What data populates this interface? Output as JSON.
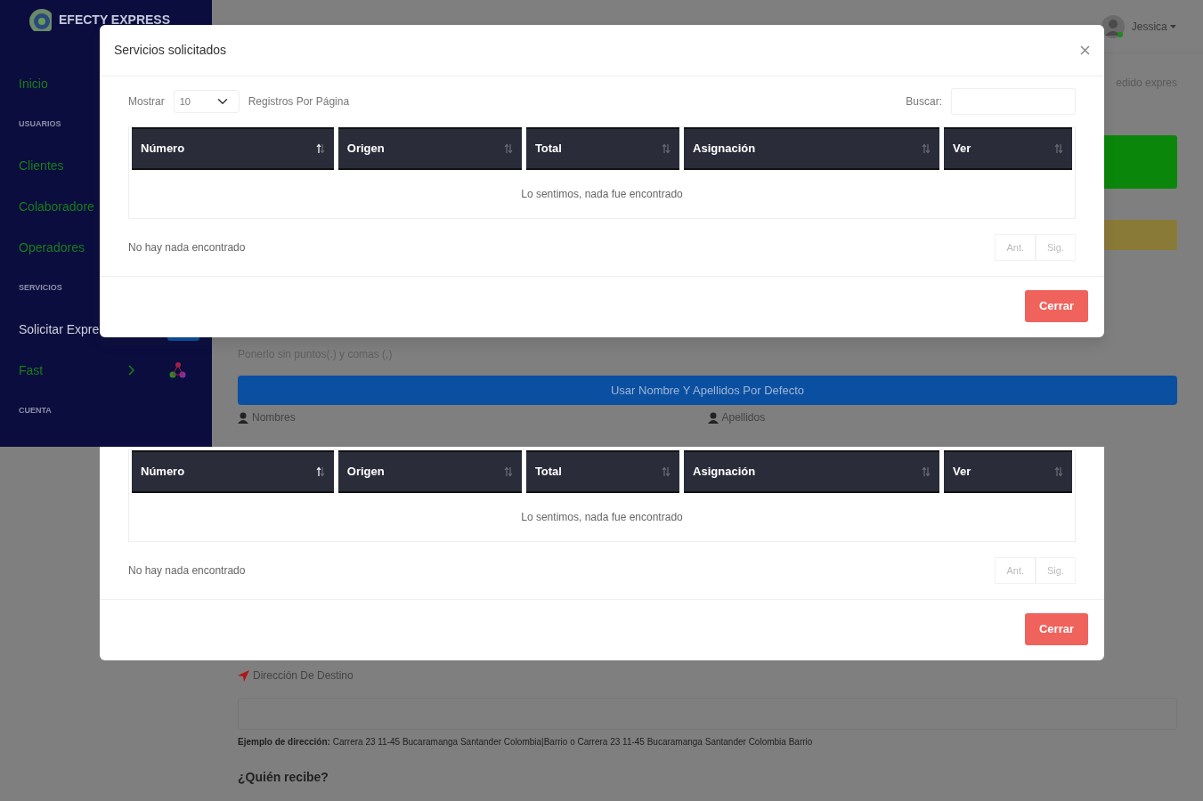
{
  "sidebar": {
    "brand": "EFECTY EXPRESS",
    "items": [
      {
        "kind": "link",
        "label": "Inicio",
        "selected": false
      },
      {
        "kind": "heading",
        "label": "USUARIOS",
        "selected": false
      },
      {
        "kind": "link",
        "label": "Clientes",
        "selected": false
      },
      {
        "kind": "link",
        "label": "Colaboradore",
        "selected": false
      },
      {
        "kind": "link",
        "label": "Operadores",
        "selected": false
      },
      {
        "kind": "heading",
        "label": "SERVICIOS",
        "selected": false
      },
      {
        "kind": "app",
        "label": "Solicitar Expre",
        "selected": true
      },
      {
        "kind": "submenu",
        "label": "Fast",
        "selected": false
      },
      {
        "kind": "heading",
        "label": "CUENTA",
        "selected": false
      }
    ]
  },
  "topbar": {
    "user": "Jessica"
  },
  "content": {
    "side_text": "edido expres",
    "hint": "Ponerlo sin puntos(.) y comas (,)",
    "default_button": "Usar Nombre Y Apellidos Por Defecto",
    "name_labels": [
      "Nombres",
      "Apellidos"
    ],
    "destination_label": "Dirección De Destino",
    "example": "**Ejemplo de dirección:** Carrera 23 11-45 Bucaramanga Santander Colombia|Barrio o Carrera 23 11-45 Bucaramanga Santander Colombia Barrio",
    "receiver_heading": "¿Quién recibe?"
  },
  "modal": {
    "title": "Servicios solicitados",
    "length_label": "Mostrar",
    "page_size": "10",
    "length_suffix": "Registros Por Página",
    "search_label": "Buscar:",
    "columns": [
      {
        "label": "Número",
        "sorted": true
      },
      {
        "label": "Origen",
        "sorted": false
      },
      {
        "label": "Total",
        "sorted": false
      },
      {
        "label": "Asignación",
        "sorted": false
      },
      {
        "label": "Ver",
        "sorted": false
      }
    ],
    "empty_message": "Lo sentimos, nada fue encontrado",
    "info": "No hay nada encontrado",
    "pagination": [
      {
        "label": "Ant.",
        "disabled": true
      },
      {
        "label": "Sig.",
        "disabled": true
      }
    ],
    "close_button": "Cerrar"
  },
  "modal_copy": {
    "columns": [
      {
        "label": "Número",
        "sorted": true
      },
      {
        "label": "Origen",
        "sorted": false
      },
      {
        "label": "Total",
        "sorted": false
      },
      {
        "label": "Asignación",
        "sorted": false
      },
      {
        "label": "Ver",
        "sorted": false
      }
    ],
    "empty_message": "Lo sentimos, nada fue encontrado",
    "info": "No hay nada encontrado",
    "pagination": [
      {
        "label": "Ant.",
        "disabled": true
      },
      {
        "label": "Sig.",
        "disabled": true
      }
    ],
    "close_button": "Cerrar"
  }
}
